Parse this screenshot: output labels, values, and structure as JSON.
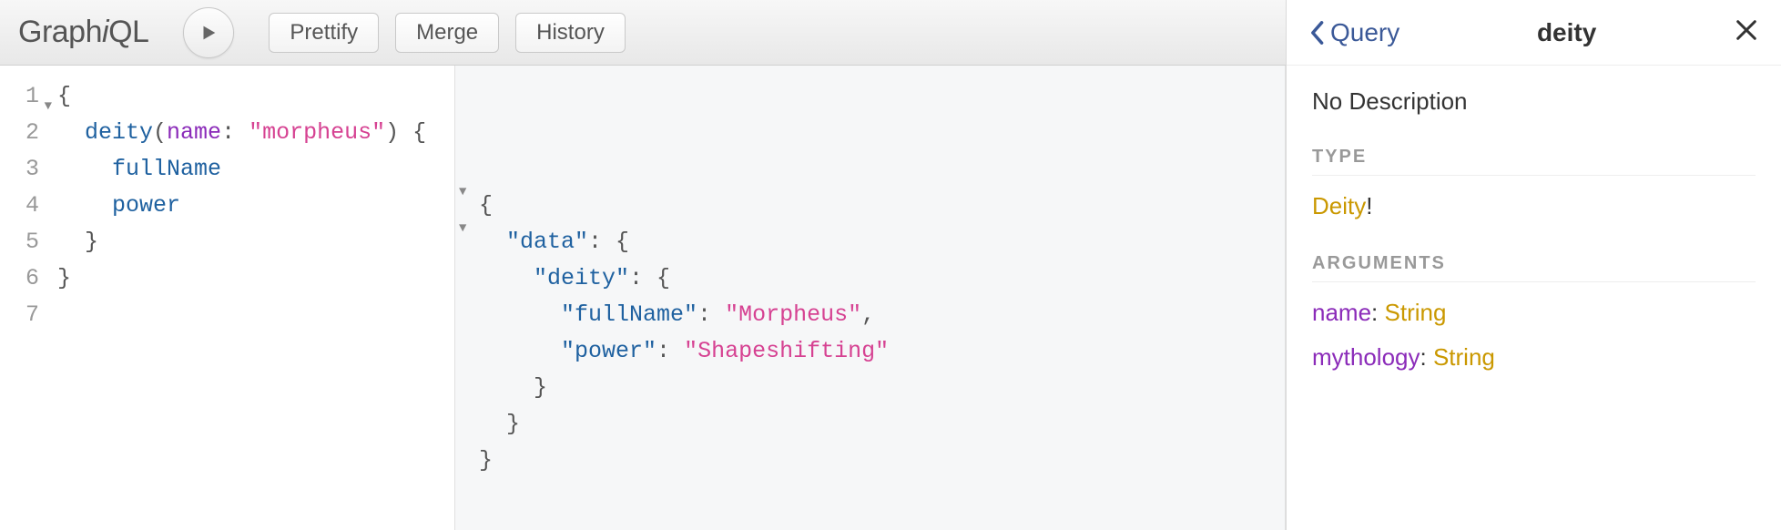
{
  "logo": {
    "prefix": "Graph",
    "i": "i",
    "suffix": "QL"
  },
  "toolbar": {
    "prettify": "Prettify",
    "merge": "Merge",
    "history": "History"
  },
  "editor": {
    "lineNumbers": [
      "1",
      "2",
      "3",
      "4",
      "5",
      "6",
      "7"
    ],
    "lines": [
      {
        "indent": 0,
        "tokens": [
          {
            "t": "{",
            "c": "punc"
          }
        ]
      },
      {
        "indent": 1,
        "tokens": [
          {
            "t": "deity",
            "c": "field"
          },
          {
            "t": "(",
            "c": "punc"
          },
          {
            "t": "name",
            "c": "attr"
          },
          {
            "t": ": ",
            "c": "punc"
          },
          {
            "t": "\"morpheus\"",
            "c": "str"
          },
          {
            "t": ") {",
            "c": "punc"
          }
        ]
      },
      {
        "indent": 2,
        "tokens": [
          {
            "t": "fullName",
            "c": "field"
          }
        ]
      },
      {
        "indent": 2,
        "tokens": [
          {
            "t": "power",
            "c": "field"
          }
        ]
      },
      {
        "indent": 1,
        "tokens": [
          {
            "t": "}",
            "c": "punc"
          }
        ]
      },
      {
        "indent": 0,
        "tokens": [
          {
            "t": "}",
            "c": "punc"
          }
        ]
      },
      {
        "indent": 0,
        "tokens": []
      }
    ]
  },
  "result": {
    "lines": [
      {
        "indent": 0,
        "tokens": [
          {
            "t": "{",
            "c": "punc"
          }
        ]
      },
      {
        "indent": 1,
        "tokens": [
          {
            "t": "\"data\"",
            "c": "key"
          },
          {
            "t": ": {",
            "c": "punc"
          }
        ]
      },
      {
        "indent": 2,
        "tokens": [
          {
            "t": "\"deity\"",
            "c": "key"
          },
          {
            "t": ": {",
            "c": "punc"
          }
        ]
      },
      {
        "indent": 3,
        "tokens": [
          {
            "t": "\"fullName\"",
            "c": "key"
          },
          {
            "t": ": ",
            "c": "punc"
          },
          {
            "t": "\"Morpheus\"",
            "c": "str"
          },
          {
            "t": ",",
            "c": "punc"
          }
        ]
      },
      {
        "indent": 3,
        "tokens": [
          {
            "t": "\"power\"",
            "c": "key"
          },
          {
            "t": ": ",
            "c": "punc"
          },
          {
            "t": "\"Shapeshifting\"",
            "c": "str"
          }
        ]
      },
      {
        "indent": 2,
        "tokens": [
          {
            "t": "}",
            "c": "punc"
          }
        ]
      },
      {
        "indent": 1,
        "tokens": [
          {
            "t": "}",
            "c": "punc"
          }
        ]
      },
      {
        "indent": 0,
        "tokens": [
          {
            "t": "}",
            "c": "punc"
          }
        ]
      }
    ]
  },
  "docs": {
    "back": "Query",
    "title": "deity",
    "description": "No Description",
    "typeLabel": "TYPE",
    "typeName": "Deity",
    "typeBang": "!",
    "argsLabel": "ARGUMENTS",
    "args": [
      {
        "name": "name",
        "type": "String"
      },
      {
        "name": "mythology",
        "type": "String"
      }
    ]
  }
}
